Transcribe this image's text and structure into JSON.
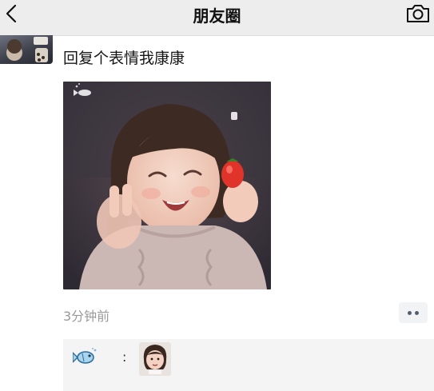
{
  "nav": {
    "title": "朋友圈",
    "back_icon": "chevron-left-icon",
    "camera_icon": "camera-icon"
  },
  "post": {
    "text": "回复个表情我康康",
    "image_subject": "smiling child holding a strawberry",
    "timestamp": "3分钟前",
    "more_icon": "two-dots-icon"
  },
  "comment": {
    "user_icon": "fish-icon",
    "separator": ":",
    "sticker_icon": "child-face-sticker-icon"
  },
  "colors": {
    "topbar_bg": "#ededed",
    "timestamp": "#9a9a9a",
    "comment_bg": "#f4f4f4",
    "more_dots": "#555d73"
  }
}
